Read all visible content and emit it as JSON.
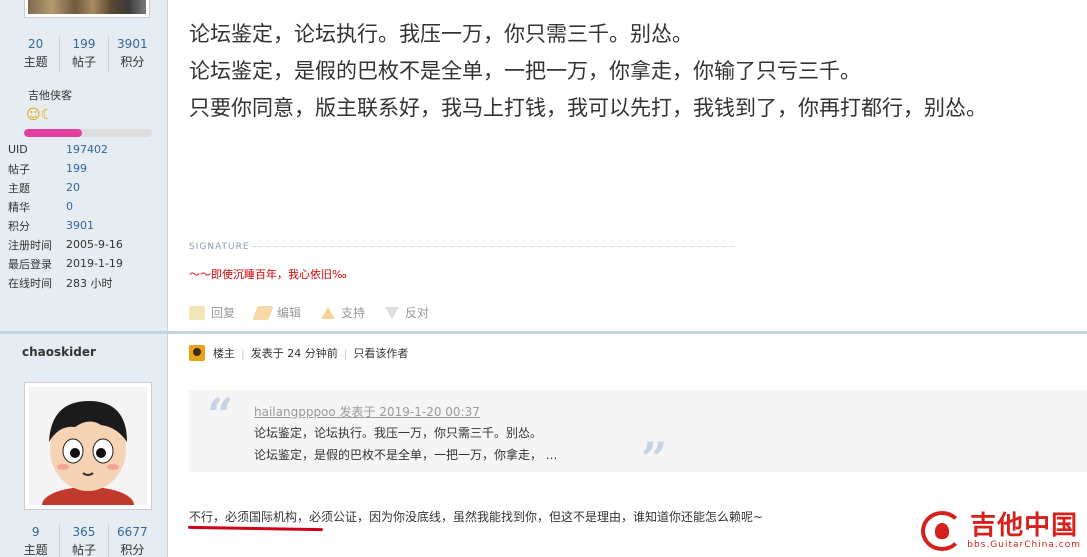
{
  "user1": {
    "stats": [
      {
        "value": "20",
        "label": "主题"
      },
      {
        "value": "199",
        "label": "帖子"
      },
      {
        "value": "3901",
        "label": "积分"
      }
    ],
    "group": "吉他侠客",
    "info": [
      {
        "key": "UID",
        "value": "197402"
      },
      {
        "key": "帖子",
        "value": "199"
      },
      {
        "key": "主题",
        "value": "20"
      },
      {
        "key": "精华",
        "value": "0"
      },
      {
        "key": "积分",
        "value": "3901"
      },
      {
        "key": "注册时间",
        "value": "2005-9-16"
      },
      {
        "key": "最后登录",
        "value": "2019-1-19"
      },
      {
        "key": "在线时间",
        "value": "283 小时"
      }
    ]
  },
  "post1": {
    "lines": [
      "论坛鉴定，论坛执行。我压一万，你只需三千。别怂。",
      "论坛鉴定，是假的巴枚不是全单，一把一万，你拿走，你输了只亏三千。",
      "只要你同意，版主联系好，我马上打钱，我可以先打，我钱到了，你再打都行，别怂。"
    ],
    "signature_label": "SIGNATURE",
    "signature": "～～即使沉睡百年，我心依旧‰",
    "actions": {
      "reply": "回复",
      "edit": "编辑",
      "support": "支持",
      "oppose": "反对"
    }
  },
  "user2": {
    "name": "chaoskider",
    "stats": [
      {
        "value": "9",
        "label": "主题"
      },
      {
        "value": "365",
        "label": "帖子"
      },
      {
        "value": "6677",
        "label": "积分"
      }
    ]
  },
  "post2": {
    "owner": "楼主",
    "posted": "发表于 24 分钟前",
    "only_author": "只看该作者",
    "quote": {
      "head": "hailangpppoo 发表于 2019-1-20 00:37",
      "line1": "论坛鉴定，论坛执行。我压一万，你只需三千。别怂。",
      "line2": "论坛鉴定，是假的巴枚不是全单，一把一万，你拿走， ..."
    },
    "reply": "不行，必须国际机构，必须公证，因为你没底线，虽然我能找到你，但这不是理由，谁知道你还能怎么赖呢~"
  },
  "logo": {
    "big": "吉他中国",
    "small": "bbs.GuitarChina.com"
  },
  "colors": {
    "accent": "#336699",
    "sidebar": "#e5edf2",
    "underline": "#d0021b",
    "logo": "#d6201c"
  }
}
